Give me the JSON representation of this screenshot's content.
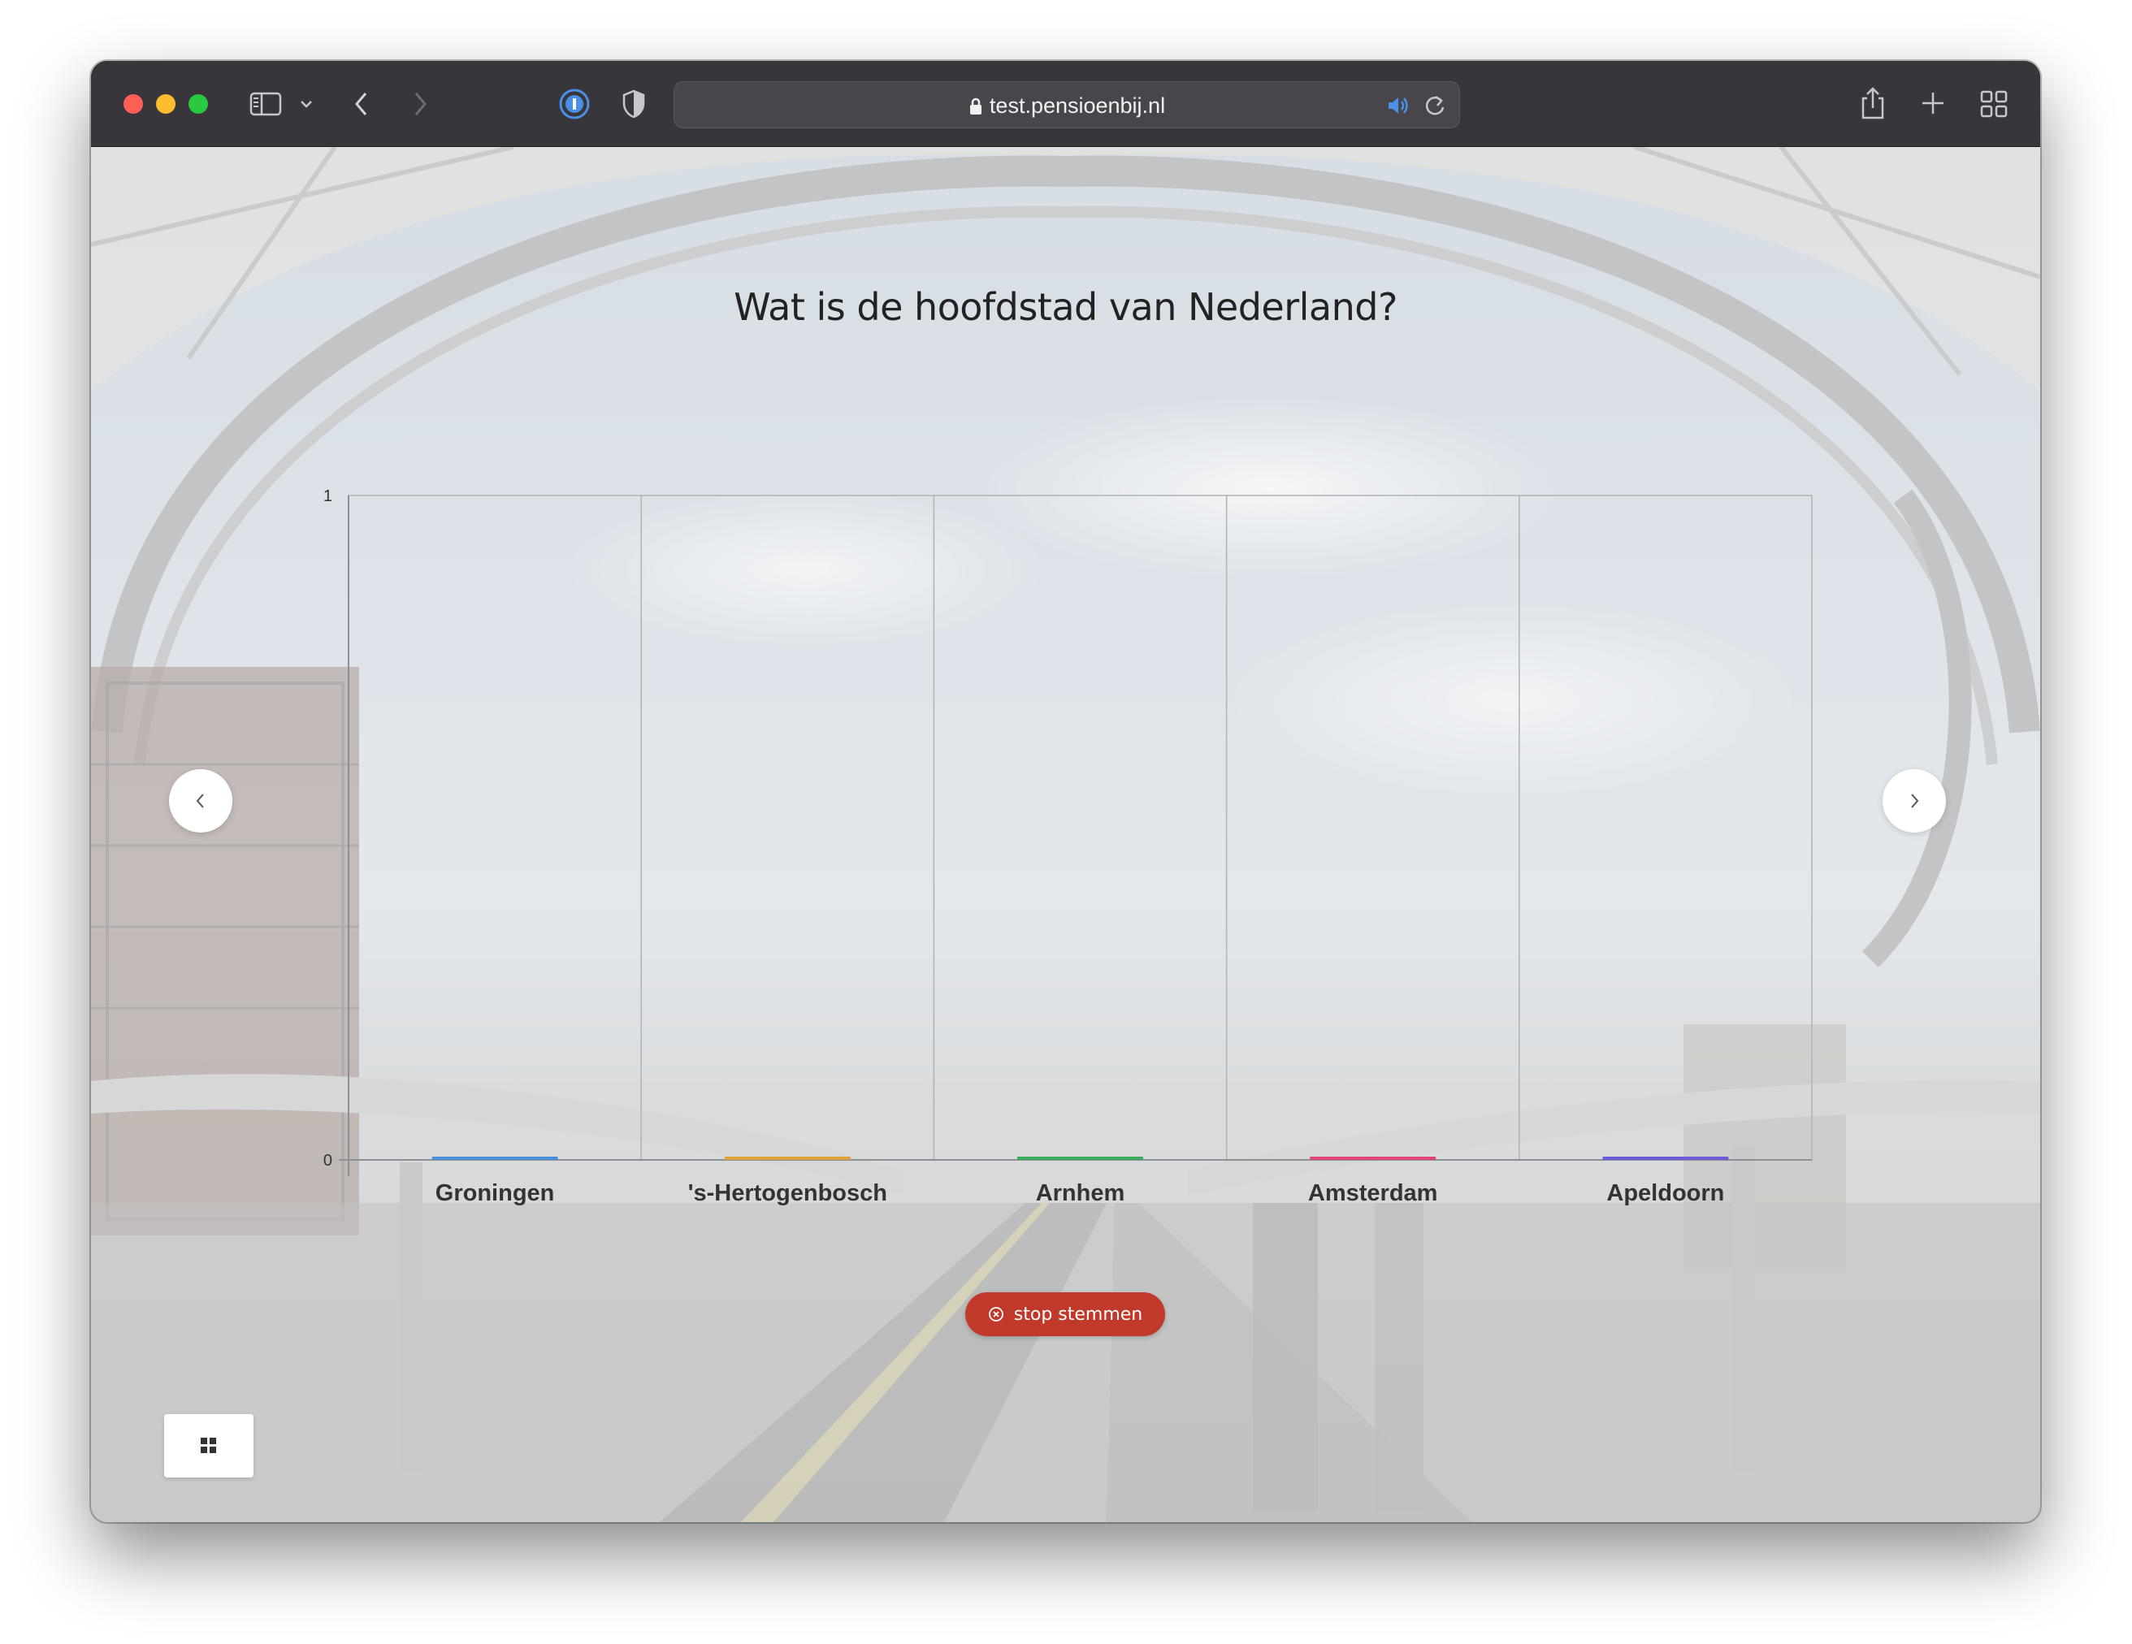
{
  "browser": {
    "url": "test.pensioenbij.nl"
  },
  "question": "Wat is de hoofdstad van Nederland?",
  "stop_button": {
    "label": "stop stemmen",
    "color": "#c0392b"
  },
  "icons": {
    "sidebar": "sidebar-icon",
    "back": "chevron-left-icon",
    "forward": "chevron-right-icon",
    "password": "password-manager-icon",
    "privacy": "shield-icon",
    "lock": "lock-icon",
    "audio": "speaker-icon",
    "reload": "reload-icon",
    "share": "share-icon",
    "new_tab": "plus-icon",
    "tab_overview": "tab-overview-icon",
    "grid": "grid-icon"
  },
  "chart_data": {
    "type": "bar",
    "categories": [
      "Groningen",
      "'s-Hertogenbosch",
      "Arnhem",
      "Amsterdam",
      "Apeldoorn"
    ],
    "values": [
      0,
      0,
      0,
      0,
      0
    ],
    "colors": [
      "#4a90d9",
      "#e0a33a",
      "#3aaa5c",
      "#e0457b",
      "#6b5bd6"
    ],
    "ylim": [
      0,
      1
    ],
    "yticks": [
      "0",
      "1"
    ],
    "grid": true
  }
}
